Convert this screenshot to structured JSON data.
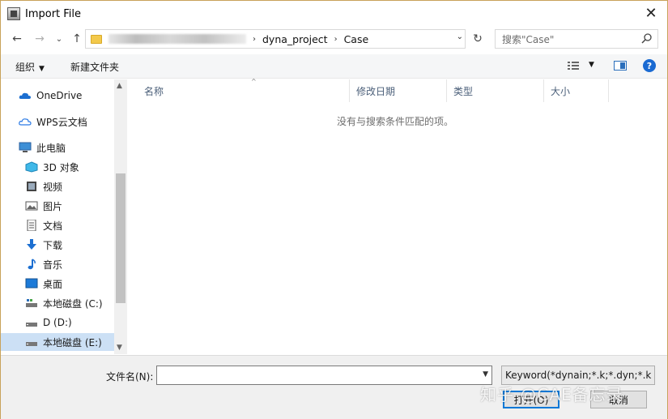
{
  "window": {
    "title": "Import File",
    "close_glyph": "✕"
  },
  "nav": {
    "back": "←",
    "forward": "→",
    "recent": "⌄",
    "up": "↑",
    "path": [
      "dyna_project",
      "Case"
    ],
    "refresh": "↻",
    "search_placeholder": "搜索\"Case\""
  },
  "toolbar": {
    "organize": "组织",
    "new_folder": "新建文件夹",
    "help": "?"
  },
  "sidebar": {
    "items": [
      {
        "label": "OneDrive",
        "icon": "onedrive-icon"
      },
      {
        "label": "WPS云文档",
        "icon": "cloud-icon"
      },
      {
        "label": "此电脑",
        "icon": "computer-icon"
      },
      {
        "label": "3D 对象",
        "icon": "3d-objects-icon"
      },
      {
        "label": "视频",
        "icon": "video-icon"
      },
      {
        "label": "图片",
        "icon": "pictures-icon"
      },
      {
        "label": "文档",
        "icon": "documents-icon"
      },
      {
        "label": "下载",
        "icon": "download-icon"
      },
      {
        "label": "音乐",
        "icon": "music-icon"
      },
      {
        "label": "桌面",
        "icon": "desktop-icon"
      },
      {
        "label": "本地磁盘 (C:)",
        "icon": "drive-icon"
      },
      {
        "label": "D (D:)",
        "icon": "drive-icon"
      },
      {
        "label": "本地磁盘 (E:)",
        "icon": "drive-icon",
        "selected": true
      }
    ]
  },
  "files": {
    "columns": [
      "名称",
      "修改日期",
      "类型",
      "大小"
    ],
    "empty_message": "没有与搜索条件匹配的项。"
  },
  "bottom": {
    "filename_label": "文件名(N):",
    "filename_value": "",
    "filter_value": "Keyword(*dynain;*.k;*.dyn;*.k",
    "open_label": "打开(O)",
    "cancel_label": "取消"
  },
  "watermark": "知乎 @CAE备忘录"
}
